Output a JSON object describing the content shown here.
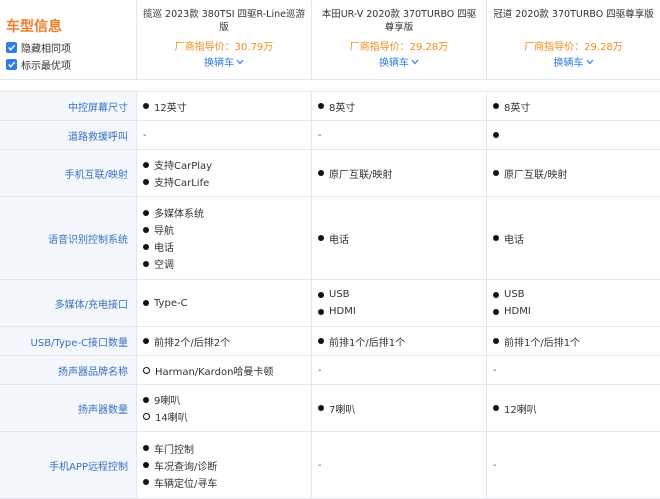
{
  "header": {
    "section_title": "车型信息",
    "options": [
      {
        "label": "隐藏相同项",
        "checked": true
      },
      {
        "label": "标示最优项",
        "checked": true
      }
    ],
    "cars": [
      {
        "name": "揽巡 2023款 380TSI 四驱R-Line巡游版",
        "price": "厂商指导价：30.79万",
        "swap": "换辆车"
      },
      {
        "name": "本田UR-V 2020款 370TURBO 四驱尊享版",
        "price": "厂商指导价：29.28万",
        "swap": "换辆车"
      },
      {
        "name": "冠道 2020款 370TURBO 四驱尊享版",
        "price": "厂商指导价：29.28万",
        "swap": "换辆车"
      }
    ]
  },
  "rows": [
    {
      "label": "中控屏幕尺寸",
      "height": 28,
      "cells": [
        [
          {
            "m": "dot",
            "t": "12英寸"
          }
        ],
        [
          {
            "m": "dot",
            "t": "8英寸"
          }
        ],
        [
          {
            "m": "dot",
            "t": "8英寸"
          }
        ]
      ]
    },
    {
      "label": "道路救援呼叫",
      "height": 28,
      "cells": [
        [
          {
            "m": "dash",
            "t": "-"
          }
        ],
        [
          {
            "m": "dash",
            "t": "-"
          }
        ],
        [
          {
            "m": "dot",
            "t": ""
          }
        ]
      ]
    },
    {
      "label": "手机互联/映射",
      "height": 46,
      "cells": [
        [
          {
            "m": "dot",
            "t": "支持CarPlay"
          },
          {
            "m": "dot",
            "t": "支持CarLife"
          }
        ],
        [
          {
            "m": "dot",
            "t": "原厂互联/映射"
          }
        ],
        [
          {
            "m": "dot",
            "t": "原厂互联/映射"
          }
        ]
      ]
    },
    {
      "label": "语音识别控制系统",
      "height": 82,
      "cells": [
        [
          {
            "m": "dot",
            "t": "多媒体系统"
          },
          {
            "m": "dot",
            "t": "导航"
          },
          {
            "m": "dot",
            "t": "电话"
          },
          {
            "m": "dot",
            "t": "空调"
          }
        ],
        [
          {
            "m": "dot",
            "t": "电话"
          }
        ],
        [
          {
            "m": "dot",
            "t": "电话"
          }
        ]
      ]
    },
    {
      "label": "多媒体/充电接口",
      "height": 46,
      "cells": [
        [
          {
            "m": "dot",
            "t": "Type-C"
          }
        ],
        [
          {
            "m": "dot",
            "t": "USB"
          },
          {
            "m": "dot",
            "t": "HDMI"
          }
        ],
        [
          {
            "m": "dot",
            "t": "USB"
          },
          {
            "m": "dot",
            "t": "HDMI"
          }
        ]
      ]
    },
    {
      "label": "USB/Type-C接口数量",
      "height": 28,
      "cells": [
        [
          {
            "m": "dot",
            "t": "前排2个/后排2个"
          }
        ],
        [
          {
            "m": "dot",
            "t": "前排1个/后排1个"
          }
        ],
        [
          {
            "m": "dot",
            "t": "前排1个/后排1个"
          }
        ]
      ]
    },
    {
      "label": "扬声器品牌名称",
      "height": 28,
      "cells": [
        [
          {
            "m": "ring",
            "t": "Harman/Kardon哈曼卡顿"
          }
        ],
        [
          {
            "m": "dash",
            "t": "-"
          }
        ],
        [
          {
            "m": "dash",
            "t": "-"
          }
        ]
      ]
    },
    {
      "label": "扬声器数量",
      "height": 46,
      "cells": [
        [
          {
            "m": "dot",
            "t": "9喇叭"
          },
          {
            "m": "ring",
            "t": "14喇叭"
          }
        ],
        [
          {
            "m": "dot",
            "t": "7喇叭"
          }
        ],
        [
          {
            "m": "dot",
            "t": "12喇叭"
          }
        ]
      ]
    },
    {
      "label": "手机APP远程控制",
      "height": 66,
      "cells": [
        [
          {
            "m": "dot",
            "t": "车门控制"
          },
          {
            "m": "dot",
            "t": "车况查询/诊断"
          },
          {
            "m": "dot",
            "t": "车辆定位/寻车"
          }
        ],
        [
          {
            "m": "dash",
            "t": "-"
          }
        ],
        [
          {
            "m": "dash",
            "t": "-"
          }
        ]
      ]
    }
  ]
}
